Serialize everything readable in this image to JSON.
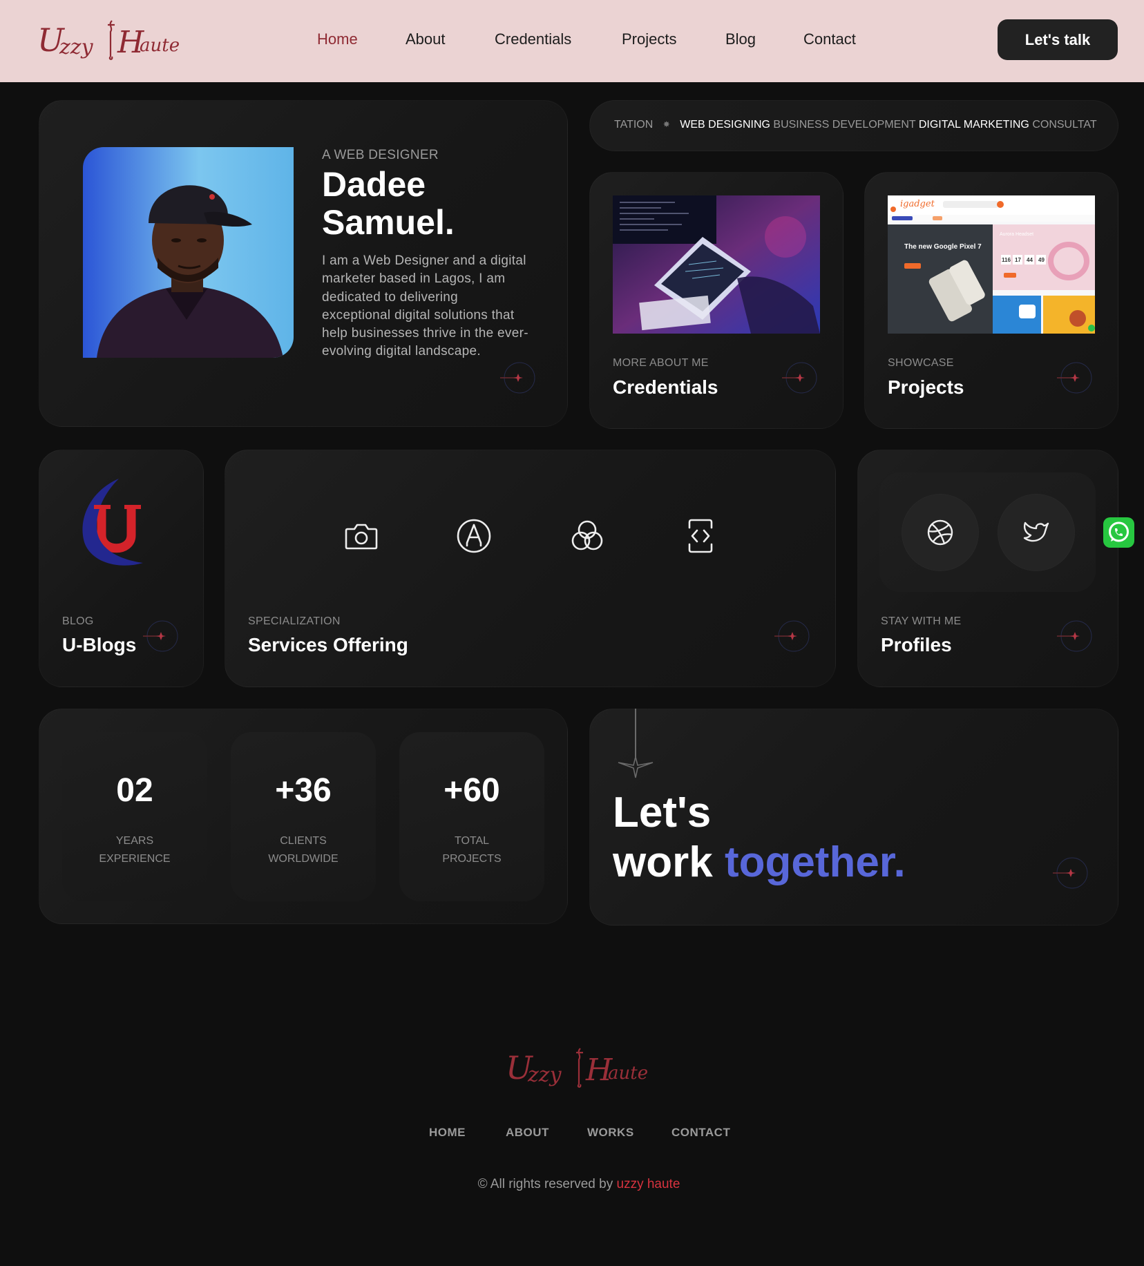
{
  "header": {
    "logo_text": "Uzzy Haute",
    "nav": [
      "Home",
      "About",
      "Credentials",
      "Projects",
      "Blog",
      "Contact"
    ],
    "active_nav": "Home",
    "cta_label": "Let's talk"
  },
  "hero": {
    "eyebrow": "A WEB DESIGNER",
    "name_line1": "Dadee",
    "name_line2": "Samuel.",
    "bio": "I am a Web Designer and a digital marketer based in Lagos, I am dedicated to delivering exceptional digital solutions that help businesses thrive in the ever-evolving digital landscape."
  },
  "marquee": {
    "items": [
      {
        "text": "TATION",
        "highlight": false
      },
      {
        "text": "WEB DESIGNING",
        "highlight": true
      },
      {
        "text": "BUSINESS DEVELOPMENT",
        "highlight": false
      },
      {
        "text": "DIGITAL MARKETING",
        "highlight": true
      },
      {
        "text": "CONSULTAT",
        "highlight": false
      }
    ]
  },
  "credentials": {
    "eyebrow": "MORE ABOUT ME",
    "title": "Credentials"
  },
  "projects": {
    "eyebrow": "SHOWCASE",
    "title": "Projects",
    "thumb_brand": "igadget",
    "thumb_headline": "The new Google Pixel 7",
    "thumb_countdown": [
      "116",
      "17",
      "44",
      "49"
    ]
  },
  "blog": {
    "eyebrow": "BLOG",
    "title": "U-Blogs"
  },
  "services": {
    "eyebrow": "SPECIALIZATION",
    "title": "Services Offering",
    "icons": [
      "camera-icon",
      "pen-tool-icon",
      "color-circles-icon",
      "code-brackets-icon"
    ]
  },
  "profiles": {
    "eyebrow": "STAY WITH ME",
    "title": "Profiles",
    "icons": [
      "dribbble-icon",
      "twitter-icon"
    ]
  },
  "stats": [
    {
      "number": "02",
      "label_line1": "YEARS",
      "label_line2": "EXPERIENCE"
    },
    {
      "number": "+36",
      "label_line1": "CLIENTS",
      "label_line2": "WORLDWIDE"
    },
    {
      "number": "+60",
      "label_line1": "TOTAL",
      "label_line2": "PROJECTS"
    }
  ],
  "together": {
    "line1": "Let's",
    "line2_plain": "work ",
    "line2_accent": "together."
  },
  "footer": {
    "logo_text": "Uzzy Haute",
    "nav": [
      "HOME",
      "ABOUT",
      "WORKS",
      "CONTACT"
    ],
    "copyright_prefix": "© All rights reserved by ",
    "copyright_brand": "uzzy haute"
  },
  "colors": {
    "header_bg": "#ebd3d3",
    "page_bg": "#0f0f0f",
    "brand_red": "#8f2a33",
    "accent_blue": "#5867d9",
    "whatsapp": "#27c740"
  }
}
